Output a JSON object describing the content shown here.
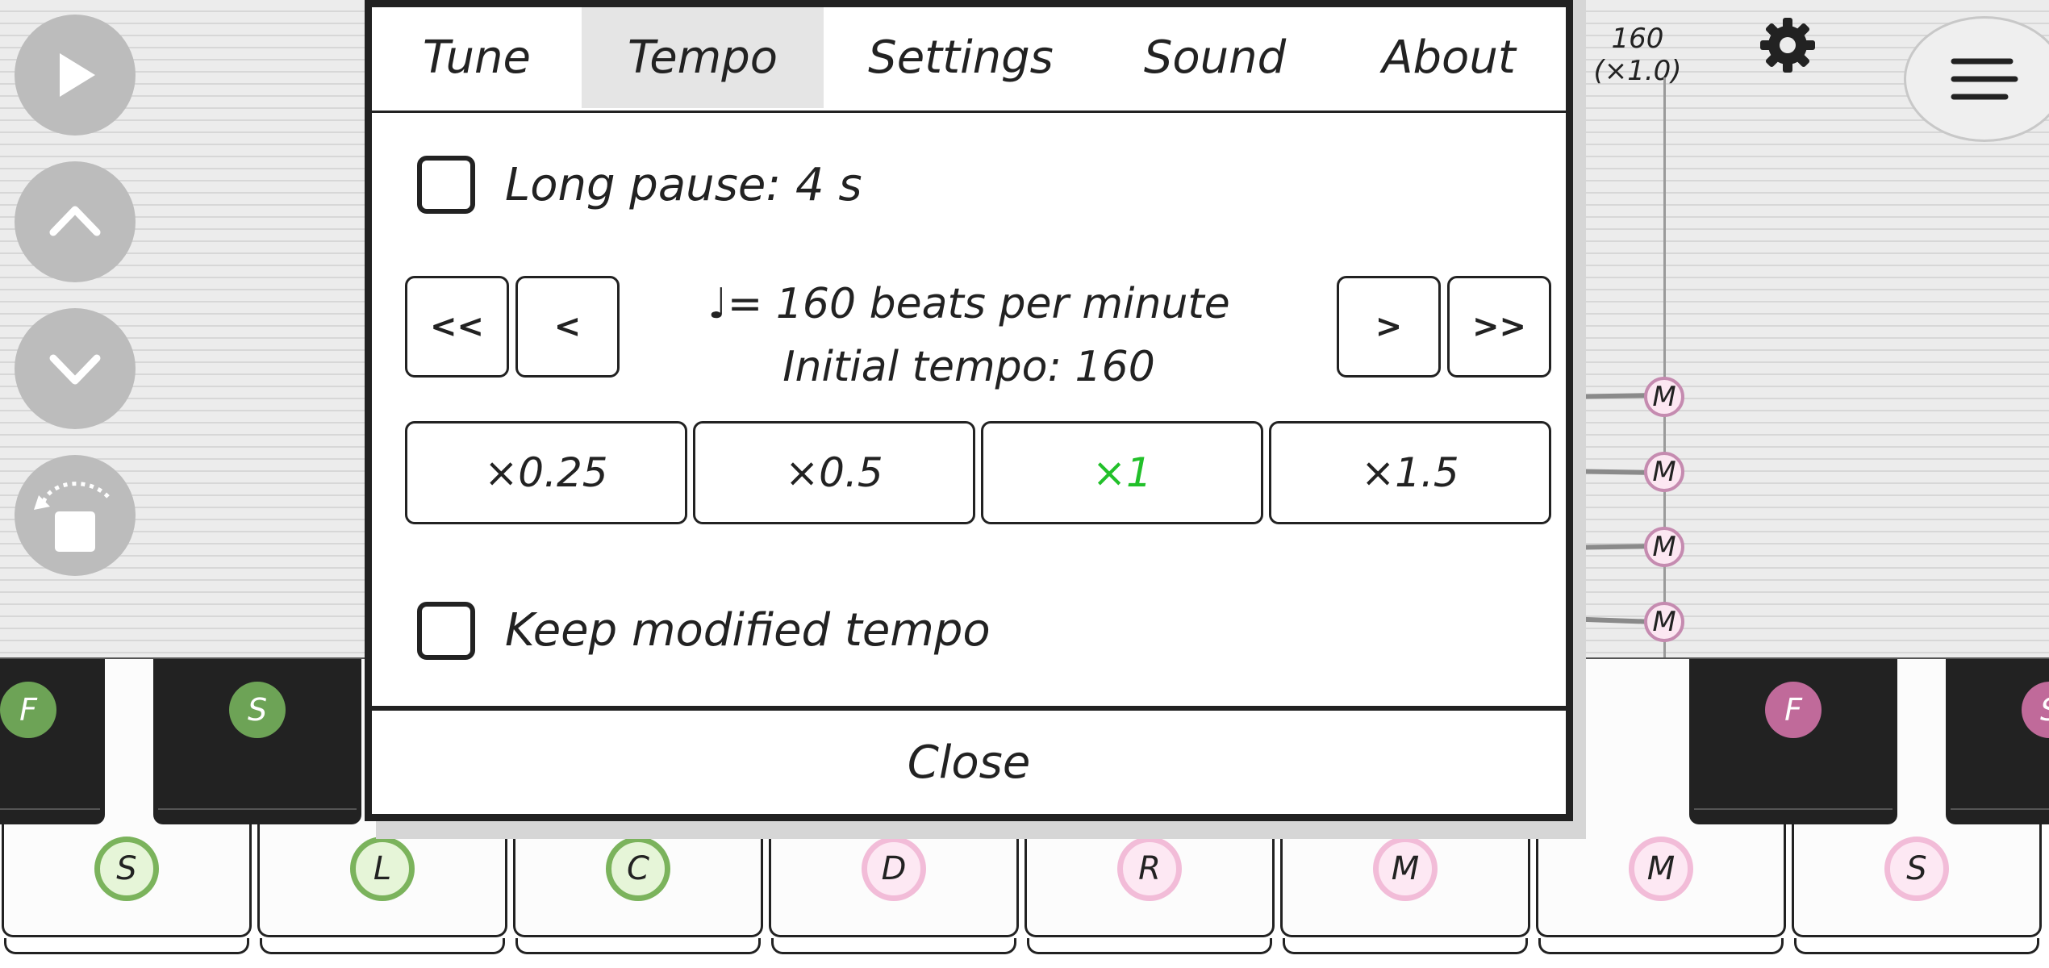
{
  "app": {
    "tempo_indicator": "160 (×1.0)",
    "side_buttons": [
      "play-icon",
      "chevron-up-icon",
      "chevron-down-icon",
      "rotate-icon"
    ],
    "staff_notes": [
      "M",
      "M",
      "M",
      "M"
    ]
  },
  "dialog": {
    "tabs": [
      {
        "label": "Tune",
        "active": false
      },
      {
        "label": "Tempo",
        "active": true
      },
      {
        "label": "Settings",
        "active": false
      },
      {
        "label": "Sound",
        "active": false
      },
      {
        "label": "About",
        "active": false
      }
    ],
    "long_pause": {
      "label": "Long pause: 4 s",
      "checked": false
    },
    "step_buttons": {
      "faster_back": "<<",
      "back": "<",
      "forward": ">",
      "faster_forward": ">>"
    },
    "tempo_text": "♩= 160 beats per minute",
    "initial_tempo": "Initial tempo: 160",
    "multipliers": [
      {
        "label": "×0.25",
        "selected": false
      },
      {
        "label": "×0.5",
        "selected": false
      },
      {
        "label": "×1",
        "selected": true
      },
      {
        "label": "×1.5",
        "selected": false
      }
    ],
    "keep_tempo": {
      "label": "Keep modified tempo",
      "checked": false
    },
    "close_label": "Close"
  },
  "keyboard": {
    "white_keys": [
      {
        "label": "S",
        "group": "green"
      },
      {
        "label": "L",
        "group": "green"
      },
      {
        "label": "C",
        "group": "green"
      },
      {
        "label": "D",
        "group": "pink"
      },
      {
        "label": "R",
        "group": "pink"
      },
      {
        "label": "M",
        "group": "pink"
      },
      {
        "label": "M",
        "group": "pink"
      },
      {
        "label": "S",
        "group": "pink"
      }
    ],
    "black_keys": [
      {
        "label": "F",
        "group": "green"
      },
      {
        "label": "S",
        "group": "green"
      },
      {
        "label": "",
        "group": "none"
      },
      {
        "label": "",
        "group": "none"
      },
      {
        "label": "",
        "group": "none"
      },
      {
        "label": "F",
        "group": "pink"
      },
      {
        "label": "S",
        "group": "pink"
      }
    ]
  },
  "colors": {
    "accent_selected": "#22c02a",
    "green_ring": "#7bb35c",
    "green_fill": "#e6f5d8",
    "pink_ring": "#f2bcd8",
    "pink_fill": "#fde8f3",
    "pink_black": "#c06a9a",
    "green_black": "#6da356"
  }
}
